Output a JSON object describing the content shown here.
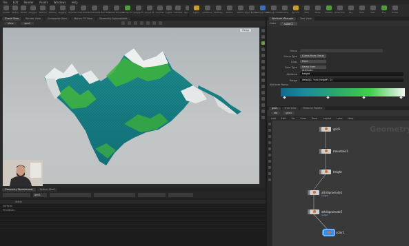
{
  "menubar": {
    "items": [
      "File",
      "Edit",
      "Render",
      "Assets",
      "Windows",
      "Help"
    ]
  },
  "shelf_left": {
    "tools": [
      {
        "label": "Create",
        "color": "grey"
      },
      {
        "label": "Modify",
        "color": "grey"
      },
      {
        "label": "Model",
        "color": "grey"
      },
      {
        "label": "Polygon",
        "color": "grey"
      },
      {
        "label": "Deform",
        "color": "grey"
      },
      {
        "label": "Texture",
        "color": "grey"
      },
      {
        "label": "Rigging",
        "color": "grey"
      },
      {
        "label": "Muscles",
        "color": "grey"
      },
      {
        "label": "Characters",
        "color": "grey"
      },
      {
        "label": "Constraints",
        "color": "grey"
      },
      {
        "label": "Hair Utils",
        "color": "grey"
      },
      {
        "label": "Guide Process",
        "color": "grey"
      },
      {
        "label": "Terrain FX",
        "color": "green"
      },
      {
        "label": "Simple FX",
        "color": "grey"
      },
      {
        "label": "Cloud FX",
        "color": "grey"
      },
      {
        "label": "Volume",
        "color": "grey"
      },
      {
        "label": "Lights",
        "color": "grey"
      },
      {
        "label": "Camera",
        "color": "grey"
      },
      {
        "label": "Render",
        "color": "grey"
      }
    ]
  },
  "shelf_right": {
    "tools": [
      {
        "label": "Lights",
        "color": "accent"
      },
      {
        "label": "Collisions",
        "color": "grey"
      },
      {
        "label": "Particles",
        "color": "grey"
      },
      {
        "label": "Grains",
        "color": "grey"
      },
      {
        "label": "Vellum",
        "color": "grey"
      },
      {
        "label": "Rigid Bodies",
        "color": "grey"
      },
      {
        "label": "Particle Fluids",
        "color": "blue"
      },
      {
        "label": "Viscous Fluids",
        "color": "grey"
      },
      {
        "label": "Oceans",
        "color": "grey"
      },
      {
        "label": "Pyro FX",
        "color": "accent"
      },
      {
        "label": "FEM",
        "color": "grey"
      },
      {
        "label": "Wires",
        "color": "grey"
      },
      {
        "label": "Crowds",
        "color": "green"
      },
      {
        "label": "Drive Sim",
        "color": "grey"
      },
      {
        "label": "Sky",
        "color": "grey"
      },
      {
        "label": "Area",
        "color": "grey"
      },
      {
        "label": "Geo",
        "color": "grey"
      },
      {
        "label": "Env",
        "color": "green"
      },
      {
        "label": "Portal",
        "color": "grey"
      }
    ]
  },
  "viewport": {
    "tabs": [
      "Scene View",
      "Render View",
      "Composite View",
      "Motion FX View",
      "Geometry Spreadsheet"
    ],
    "active_tab": "Scene View",
    "path_label": "geo1",
    "toolbar_left": "View",
    "camera_label": "Persp"
  },
  "bottom": {
    "tabs": [
      "Geometry Spreadsheet",
      "Python Shell"
    ],
    "path_label": "geo1",
    "spreadsheet_header": [
      "",
      "Attrib"
    ],
    "rows": [
      {
        "name": "Vertices",
        "value": ""
      },
      {
        "name": "Primitives",
        "value": ""
      }
    ]
  },
  "params": {
    "tabs": [
      "Attribute Wrangle",
      "Tree View"
    ],
    "node_type": "Color",
    "node_name": "color1",
    "rows": [
      {
        "label": "Group",
        "value": ""
      },
      {
        "label": "Group Type",
        "value": "Guess from Group"
      },
      {
        "label": "Class",
        "value": "Point"
      },
      {
        "label": "Color Type",
        "value": "Ramp from Attribute"
      },
      {
        "label": "Attribute",
        "value": "height"
      },
      {
        "label": "Range",
        "value": "detail(0, \"vcb_height\", 0)"
      }
    ],
    "ramp_label": "Attribute Ramp",
    "ramp_colors": [
      "#0f6b8a",
      "#1a8aa0",
      "#2aa96a",
      "#3fd04a",
      "#f4f4f4"
    ],
    "ramp_markers": [
      0.03,
      0.38,
      0.67,
      0.97
    ]
  },
  "network": {
    "tabs": [
      "geo1",
      "Tree View",
      "Material Palette"
    ],
    "path": [
      "obj",
      "geo1"
    ],
    "menu": [
      "Add",
      "Edit",
      "Go",
      "View",
      "Tools",
      "Layout",
      "Labs",
      "Help"
    ],
    "watermark": "Geometry",
    "nodes": [
      {
        "name": "grid1",
        "sub": "",
        "display": false
      },
      {
        "name": "mountain1",
        "sub": "",
        "display": false
      },
      {
        "name": "height",
        "sub": "",
        "display": false
      },
      {
        "name": "attribpromote1",
        "sub": "height",
        "display": false
      },
      {
        "name": "attribpromote2",
        "sub": "height",
        "display": false
      },
      {
        "name": "color1",
        "sub": "",
        "display": true
      }
    ]
  }
}
